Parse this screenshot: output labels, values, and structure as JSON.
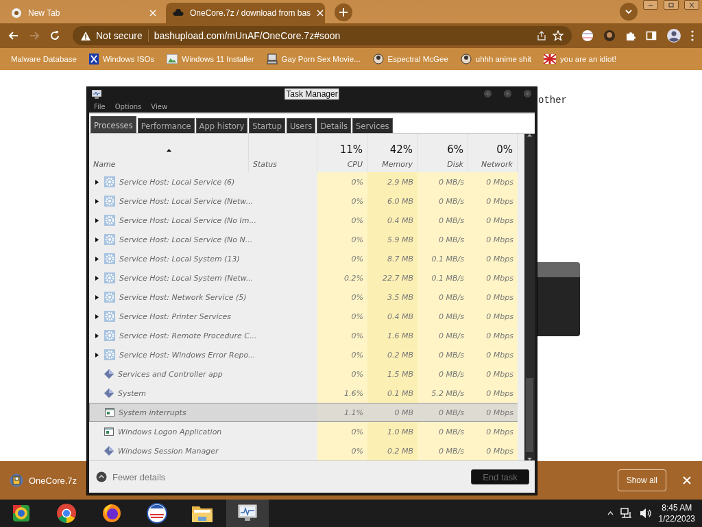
{
  "browser": {
    "tabs": [
      {
        "title": "New Tab",
        "kind": "ring",
        "selected": false
      },
      {
        "title": "OneCore.7z / download from bas",
        "kind": "cloud",
        "selected": true
      }
    ],
    "address": {
      "security": "Not secure",
      "url": "bashupload.com/mUnAF/OneCore.7z#soon"
    },
    "bookmarks": [
      {
        "label": "Malware Database",
        "kind": "none"
      },
      {
        "label": "Windows ISOs",
        "kind": "x-tile"
      },
      {
        "label": "Windows 11 Installer",
        "kind": "image-tile"
      },
      {
        "label": "Gay Porn Sex Movie...",
        "kind": "computer"
      },
      {
        "label": "Espectral McGee",
        "kind": "avatar"
      },
      {
        "label": "uhhh anime shit",
        "kind": "avatar"
      },
      {
        "label": "you are an idiot!",
        "kind": "flag"
      }
    ]
  },
  "page": {
    "text": "other"
  },
  "task_manager": {
    "title": "Task Manager",
    "menu": [
      "File",
      "Options",
      "View"
    ],
    "tabs": [
      {
        "label": "Processes",
        "selected": true
      },
      {
        "label": "Performance",
        "selected": false
      },
      {
        "label": "App history",
        "selected": false
      },
      {
        "label": "Startup",
        "selected": false
      },
      {
        "label": "Users",
        "selected": false
      },
      {
        "label": "Details",
        "selected": false
      },
      {
        "label": "Services",
        "selected": false
      }
    ],
    "columns": [
      {
        "label": "Name"
      },
      {
        "label": "Status"
      },
      {
        "label": "CPU",
        "summary": "11%"
      },
      {
        "label": "Memory",
        "summary": "42%"
      },
      {
        "label": "Disk",
        "summary": "6%"
      },
      {
        "label": "Network",
        "summary": "0%"
      }
    ],
    "rows": [
      {
        "kind": "service",
        "expanded": false,
        "selected": false,
        "name": "Service Host: Local Service (6)",
        "cpu": "0%",
        "memory": "2.9 MB",
        "disk": "0 MB/s",
        "network": "0 Mbps"
      },
      {
        "kind": "service",
        "expanded": false,
        "selected": false,
        "name": "Service Host: Local Service (Netw...",
        "cpu": "0%",
        "memory": "6.0 MB",
        "disk": "0 MB/s",
        "network": "0 Mbps"
      },
      {
        "kind": "service",
        "expanded": false,
        "selected": false,
        "name": "Service Host: Local Service (No Im...",
        "cpu": "0%",
        "memory": "0.4 MB",
        "disk": "0 MB/s",
        "network": "0 Mbps"
      },
      {
        "kind": "service",
        "expanded": false,
        "selected": false,
        "name": "Service Host: Local Service (No N...",
        "cpu": "0%",
        "memory": "5.9 MB",
        "disk": "0 MB/s",
        "network": "0 Mbps"
      },
      {
        "kind": "service",
        "expanded": false,
        "selected": false,
        "name": "Service Host: Local System (13)",
        "cpu": "0%",
        "memory": "8.7 MB",
        "disk": "0.1 MB/s",
        "network": "0 Mbps"
      },
      {
        "kind": "service",
        "expanded": false,
        "selected": false,
        "name": "Service Host: Local System (Netw...",
        "cpu": "0.2%",
        "memory": "22.7 MB",
        "disk": "0.1 MB/s",
        "network": "0 Mbps"
      },
      {
        "kind": "service",
        "expanded": false,
        "selected": false,
        "name": "Service Host: Network Service (5)",
        "cpu": "0%",
        "memory": "3.5 MB",
        "disk": "0 MB/s",
        "network": "0 Mbps"
      },
      {
        "kind": "service",
        "expanded": false,
        "selected": false,
        "name": "Service Host: Printer Services",
        "cpu": "0%",
        "memory": "0.4 MB",
        "disk": "0 MB/s",
        "network": "0 Mbps"
      },
      {
        "kind": "service",
        "expanded": false,
        "selected": false,
        "name": "Service Host: Remote Procedure C...",
        "cpu": "0%",
        "memory": "1.6 MB",
        "disk": "0 MB/s",
        "network": "0 Mbps"
      },
      {
        "kind": "service",
        "expanded": false,
        "selected": false,
        "name": "Service Host: Windows Error Repo...",
        "cpu": "0%",
        "memory": "0.2 MB",
        "disk": "0 MB/s",
        "network": "0 Mbps"
      },
      {
        "kind": "app",
        "selected": false,
        "name": "Services and Controller app",
        "cpu": "0%",
        "memory": "1.5 MB",
        "disk": "0 MB/s",
        "network": "0 Mbps"
      },
      {
        "kind": "app",
        "selected": false,
        "name": "System",
        "cpu": "1.6%",
        "memory": "0.1 MB",
        "disk": "5.2 MB/s",
        "network": "0 Mbps"
      },
      {
        "kind": "window",
        "selected": true,
        "name": "System interrupts",
        "cpu": "1.1%",
        "memory": "0 MB",
        "disk": "0 MB/s",
        "network": "0 Mbps"
      },
      {
        "kind": "window",
        "selected": false,
        "name": "Windows Logon Application",
        "cpu": "0%",
        "memory": "1.0 MB",
        "disk": "0 MB/s",
        "network": "0 Mbps"
      },
      {
        "kind": "app",
        "selected": false,
        "name": "Windows Session Manager",
        "cpu": "0%",
        "memory": "0.2 MB",
        "disk": "0 MB/s",
        "network": "0 Mbps"
      }
    ],
    "footer": {
      "toggle": "Fewer details",
      "button": "End task"
    }
  },
  "downloads": {
    "items": [
      "OneCore.7z"
    ],
    "show_all": "Show all"
  },
  "taskbar": {
    "apps": [
      {
        "kind": "ring",
        "selected": false
      },
      {
        "kind": "chrome",
        "selected": false
      },
      {
        "kind": "fox",
        "selected": false
      },
      {
        "kind": "stripe-circle",
        "selected": false
      },
      {
        "kind": "folder",
        "selected": false
      },
      {
        "kind": "monitor",
        "selected": true
      }
    ],
    "time": "8:45 AM",
    "date": "1/22/2023"
  }
}
